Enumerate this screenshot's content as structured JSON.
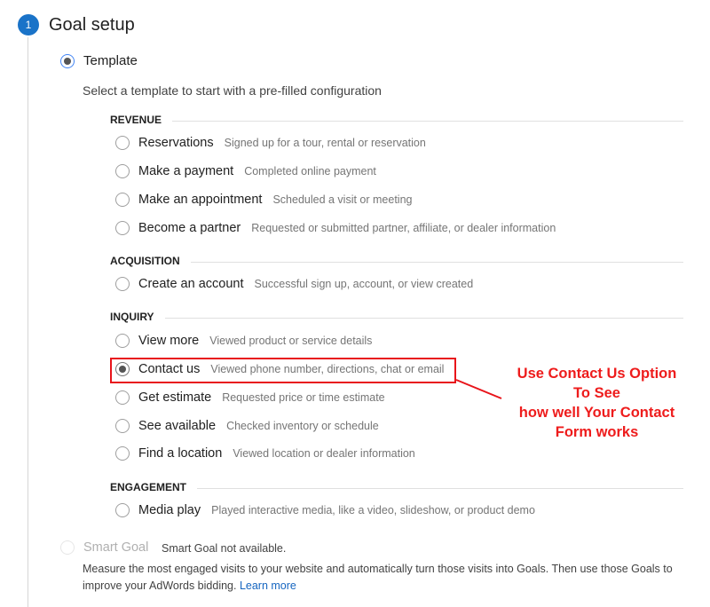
{
  "step": {
    "number": "1",
    "title": "Goal setup",
    "accent": "#1a73c8"
  },
  "template": {
    "label": "Template",
    "selected": true,
    "intro": "Select a template to start with a pre-filled configuration"
  },
  "sections": [
    {
      "header": "REVENUE",
      "options": [
        {
          "label": "Reservations",
          "desc": "Signed up for a tour, rental or reservation",
          "selected": false
        },
        {
          "label": "Make a payment",
          "desc": "Completed online payment",
          "selected": false
        },
        {
          "label": "Make an appointment",
          "desc": "Scheduled a visit or meeting",
          "selected": false
        },
        {
          "label": "Become a partner",
          "desc": "Requested or submitted partner, affiliate, or dealer information",
          "selected": false
        }
      ]
    },
    {
      "header": "ACQUISITION",
      "options": [
        {
          "label": "Create an account",
          "desc": "Successful sign up, account, or view created",
          "selected": false
        }
      ]
    },
    {
      "header": "INQUIRY",
      "options": [
        {
          "label": "View more",
          "desc": "Viewed product or service details",
          "selected": false
        },
        {
          "label": "Contact us",
          "desc": "Viewed phone number, directions, chat or email",
          "selected": true
        },
        {
          "label": "Get estimate",
          "desc": "Requested price or time estimate",
          "selected": false
        },
        {
          "label": "See available",
          "desc": "Checked inventory or schedule",
          "selected": false
        },
        {
          "label": "Find a location",
          "desc": "Viewed location or dealer information",
          "selected": false
        }
      ]
    },
    {
      "header": "ENGAGEMENT",
      "options": [
        {
          "label": "Media play",
          "desc": "Played interactive media, like a video, slideshow, or product demo",
          "selected": false
        }
      ]
    }
  ],
  "annotation": {
    "lines": [
      "Use Contact Us Option",
      "To See",
      "how well Your Contact",
      "Form works"
    ],
    "color": "#ee1c1c"
  },
  "smart_goal": {
    "label": "Smart Goal",
    "note": "Smart Goal not available.",
    "description": "Measure the most engaged visits to your website and automatically turn those visits into Goals. Then use those Goals to improve your AdWords bidding.",
    "learn_more": "Learn more",
    "disabled": true
  }
}
